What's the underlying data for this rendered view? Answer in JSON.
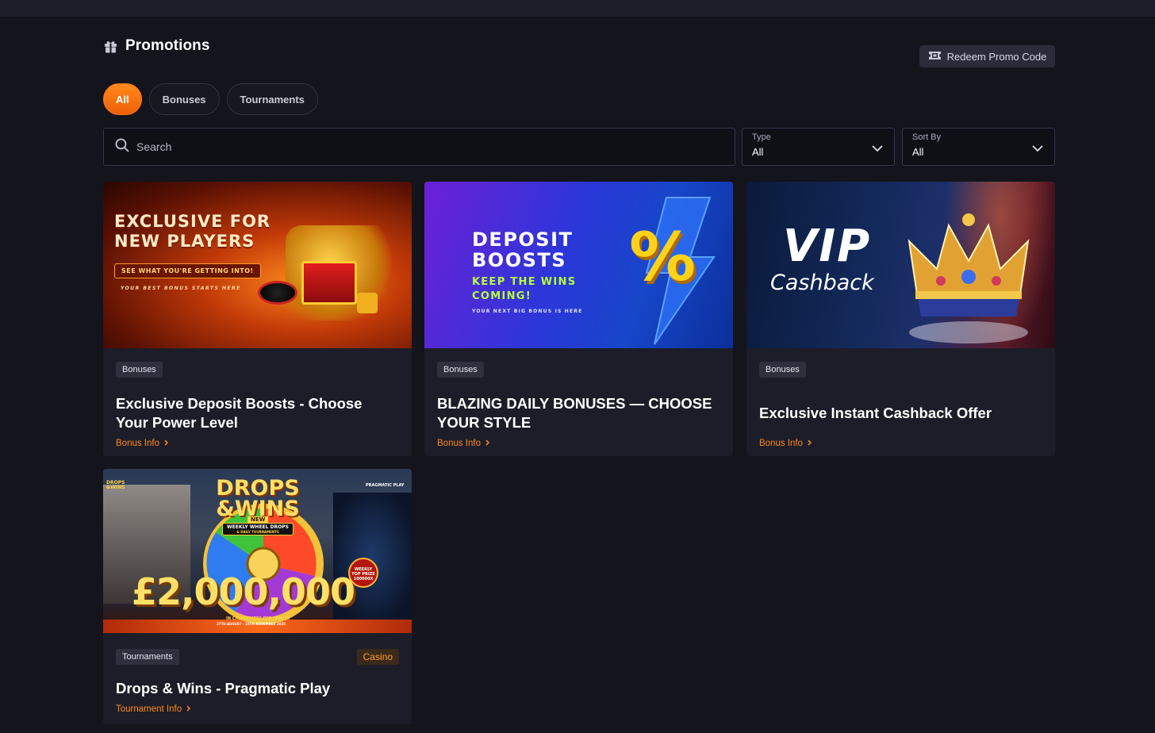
{
  "page": {
    "title": "Promotions",
    "redeem_label": "Redeem Promo Code"
  },
  "tabs": [
    {
      "label": "All",
      "active": true
    },
    {
      "label": "Bonuses",
      "active": false
    },
    {
      "label": "Tournaments",
      "active": false
    }
  ],
  "filters": {
    "search_placeholder": "Search",
    "type_label": "Type",
    "type_value": "All",
    "sort_label": "Sort By",
    "sort_value": "All"
  },
  "cards": [
    {
      "category": "Bonuses",
      "title": "Exclusive Deposit Boosts - Choose Your Power Level",
      "link": "Bonus Info",
      "banner": {
        "line1": "EXCLUSIVE FOR",
        "line2": "NEW PLAYERS",
        "ribbon": "SEE WHAT YOU'RE GETTING INTO!",
        "tagline": "YOUR BEST BONUS STARTS HERE"
      }
    },
    {
      "category": "Bonuses",
      "title": "BLAZING DAILY BONUSES — CHOOSE YOUR STYLE",
      "link": "Bonus Info",
      "banner": {
        "line1": "DEPOSIT",
        "line2": "BOOSTS",
        "line3": "KEEP THE WINS",
        "line4": "COMING!",
        "tagline": "YOUR NEXT BIG BONUS IS HERE",
        "symbol": "%"
      }
    },
    {
      "category": "Bonuses",
      "title": "Exclusive Instant Cashback Offer",
      "link": "Bonus Info",
      "banner": {
        "line1": "VIP",
        "line2": "Cashback"
      }
    },
    {
      "category": "Tournaments",
      "tag": "Casino",
      "title": "Drops & Wins - Pragmatic Play",
      "link": "Tournament Info",
      "banner": {
        "line1": "DROPS",
        "line2": "&WINS",
        "new": "NEW",
        "ribbon": "WEEKLY WHEEL DROPS",
        "ribbon_sub": "& DAILY TOURNAMENTS",
        "amount": "£2,000,000",
        "sub": "IN CASH PRIZES PER MONTH",
        "dates": "27TH AUGUST – 19TH NOVEMBER 2025",
        "corner_top": "DROPS",
        "corner_bottom": "&WINS",
        "provider": "PRAGMATIC PLAY",
        "medal_top": "WEEKLY",
        "medal_mid": "TOP PRIZE",
        "medal_bottom": "100000X"
      }
    }
  ],
  "colors": {
    "accent": "#ff7a12",
    "background": "#13141c",
    "card": "#1c1d28"
  }
}
